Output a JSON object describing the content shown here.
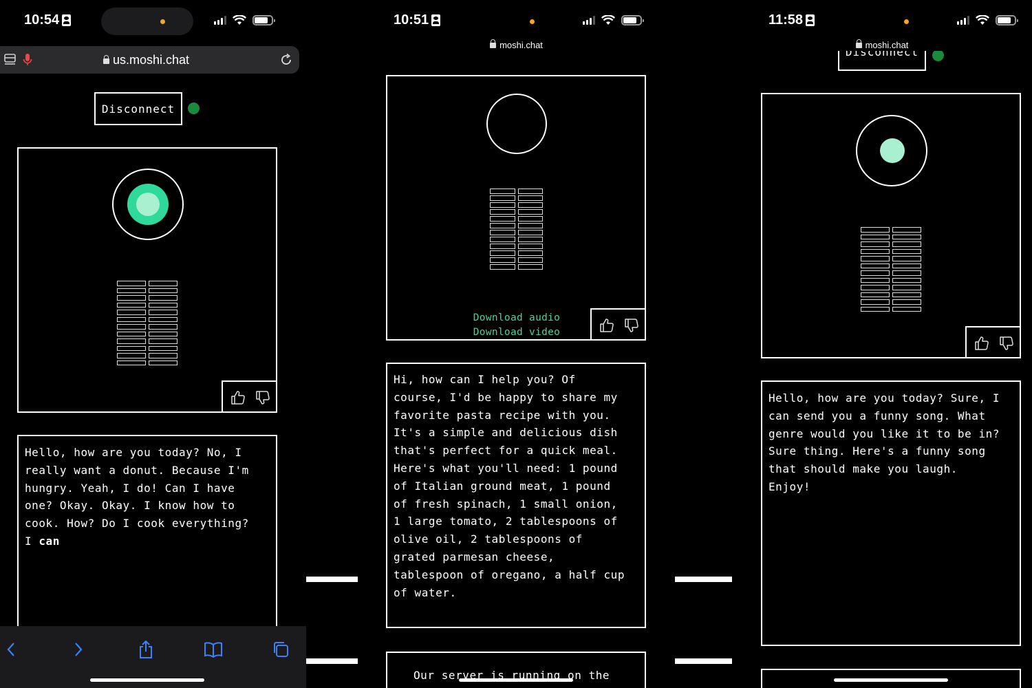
{
  "phone1": {
    "time": "10:54",
    "url": "us.moshi.chat",
    "disconnect_label": "Disconnect",
    "transcript": "Hello, how are you today? No, I\nreally want a donut. Because I'm\nhungry. Yeah, I do! Can I have\none? Okay. Okay. I know how to\ncook. How? Do I cook everything?\nI ",
    "transcript_bold": "can"
  },
  "phone2": {
    "time": "10:51",
    "url": "moshi.chat",
    "download_audio": "Download audio",
    "download_video": "Download video",
    "transcript": "Hi, how can I help you? Of\ncourse, I'd be happy to share my\nfavorite pasta recipe with you.\nIt's a simple and delicious dish\nthat's perfect for a quick meal.\nHere's what you'll need: 1 pound\nof Italian ground meat, 1 pound\nof fresh spinach, 1 small onion,\n1 large tomato, 2 tablespoons of\nolive oil, 2 tablespoons of\ngrated parmesan cheese,\ntablespoon of oregano, a half cup\nof water.",
    "server_note": "Our server is running on the"
  },
  "phone3": {
    "time": "11:58",
    "url": "moshi.chat",
    "disconnect_label": "Disconnect",
    "transcript": "Hello, how are you today? Sure, I\ncan send you a funny song. What\ngenre would you like it to be in?\nSure thing. Here's a funny song\nthat should make you laugh.\nEnjoy!"
  },
  "colors": {
    "accent_green": "#45d59c",
    "mic_red": "#e5484d",
    "status_green": "#1a8a3c",
    "ios_blue": "#3a82f7"
  },
  "icons": [
    "sidebar-icon",
    "mic-icon",
    "lock-icon",
    "reload-icon",
    "thumbs-up-icon",
    "thumbs-down-icon",
    "back-icon",
    "forward-icon",
    "share-icon",
    "bookmarks-icon",
    "tabs-icon"
  ]
}
